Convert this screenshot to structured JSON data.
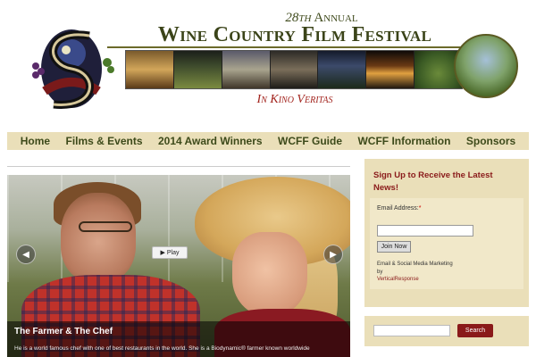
{
  "header": {
    "annual_ordinal": "28th",
    "annual_word": "Annual",
    "festival_name": "Wine Country Film Festival",
    "tagline": "In Kino Veritas"
  },
  "nav": {
    "items": [
      {
        "label": "Home"
      },
      {
        "label": "Films & Events"
      },
      {
        "label": "2014 Award Winners"
      },
      {
        "label": "WCFF Guide"
      },
      {
        "label": "WCFF Information"
      },
      {
        "label": "Sponsors"
      }
    ]
  },
  "slider": {
    "play_label": "Play",
    "caption_title": "The Farmer & The Chef",
    "caption_text": "He is a world famous chef with one of best restaurants in the world. She is a Biodynamic® farmer known worldwide",
    "prev_icon": "chevron-left-icon",
    "next_icon": "chevron-right-icon"
  },
  "signup": {
    "title": "Sign Up to Receive the Latest News!",
    "email_label": "Email Address:",
    "required_mark": "*",
    "email_value": "",
    "join_label": "Join Now",
    "powered_text": "Email & Social Media Marketing by",
    "provider_link": "VerticalResponse"
  },
  "search": {
    "value": "",
    "button_label": "Search"
  },
  "colors": {
    "nav_bg": "#eadfb9",
    "accent_red": "#8a1a1a",
    "olive_text": "#3d4a1a"
  }
}
